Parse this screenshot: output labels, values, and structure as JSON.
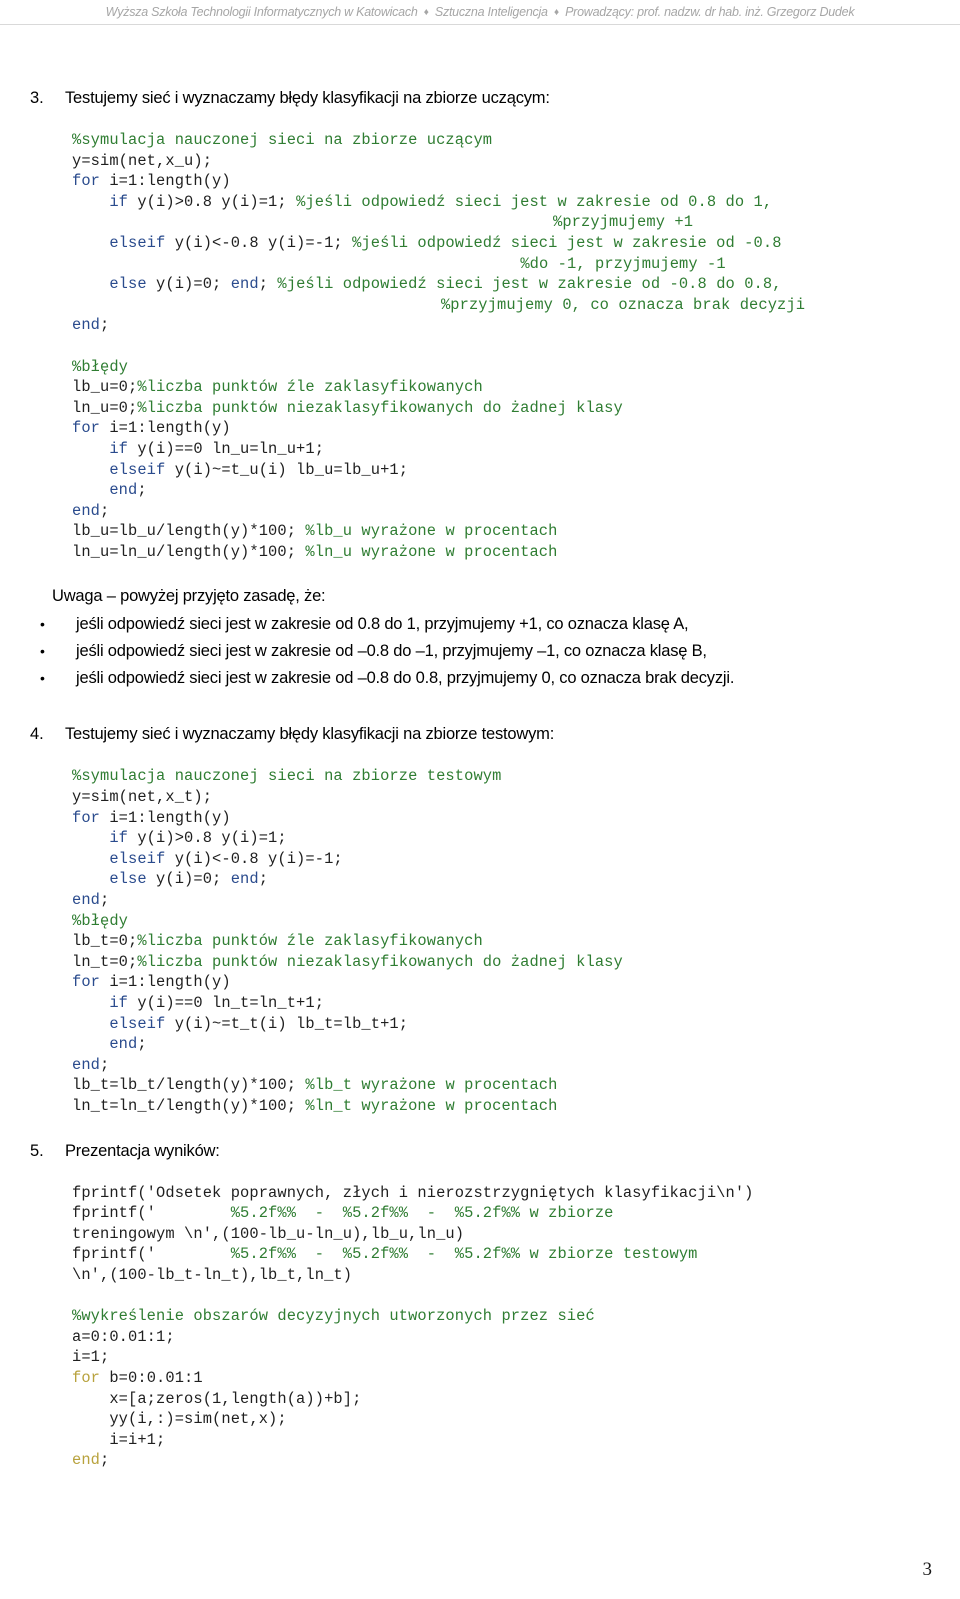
{
  "header": {
    "institution": "Wyższa Szkoła Technologii Informatycznych w Katowicach",
    "course": "Sztuczna Inteligencja",
    "lecturer": "Prowadzący: prof. nadzw. dr hab. inż. Grzegorz Dudek",
    "separator": "♦"
  },
  "colors": {
    "header_text": "#a6a6a6",
    "comment_green": "#2f7d32",
    "keyword_blue": "#2a4b8d",
    "keyword_olive": "#b8a23d",
    "body_text": "#000000"
  },
  "steps": [
    {
      "number": "3.",
      "title": "Testujemy sieć i wyznaczamy błędy klasyfikacji na zbiorze uczącym:"
    },
    {
      "number": "4.",
      "title": "Testujemy sieć i wyznaczamy błędy klasyfikacji na zbiorze testowym:"
    },
    {
      "number": "5.",
      "title": "Prezentacja wyników:"
    }
  ],
  "code_block_1": {
    "lines": [
      "%symulacja nauczonej sieci na zbiorze uczącym",
      "y=sim(net,x_u);",
      "for i=1:length(y)",
      "    if y(i)>0.8 y(i)=1; %jeśli odpowiedź sieci jest w zakresie od 0.8 do 1,",
      "                        %przyjmujemy +1",
      "    elseif y(i)<-0.8 y(i)=-1; %jeśli odpowiedź sieci jest w zakresie od -0.8",
      "                        %do -1, przyjmujemy -1",
      "    else y(i)=0; end; %jeśli odpowiedź sieci jest w zakresie od -0.8 do 0.8,",
      "                        %przyjmujemy 0, co oznacza brak decyzji",
      "end;",
      "",
      "%błędy",
      "lb_u=0;%liczba punktów źle zaklasyfikowanych",
      "ln_u=0;%liczba punktów niezaklasyfikowanych do żadnej klasy",
      "for i=1:length(y)",
      "    if y(i)==0 ln_u=ln_u+1;",
      "    elseif y(i)~=t_u(i) lb_u=lb_u+1;",
      "    end;",
      "end;",
      "lb_u=lb_u/length(y)*100; %lb_u wyrażone w procentach",
      "ln_u=ln_u/length(y)*100; %ln_u wyrażone w procentach"
    ]
  },
  "note": {
    "intro": "Uwaga – powyżej przyjęto zasadę, że:",
    "bullet_char": "•",
    "bullets": [
      "jeśli odpowiedź sieci jest w zakresie od 0.8 do 1, przyjmujemy +1, co oznacza klasę A,",
      "jeśli odpowiedź sieci jest w zakresie od –0.8 do –1, przyjmujemy –1, co oznacza klasę B,",
      "jeśli odpowiedź sieci jest w zakresie od –0.8 do 0.8, przyjmujemy 0, co oznacza brak decyzji."
    ]
  },
  "code_block_2": {
    "lines": [
      "%symulacja nauczonej sieci na zbiorze testowym",
      "y=sim(net,x_t);",
      "for i=1:length(y)",
      "    if y(i)>0.8 y(i)=1;",
      "    elseif y(i)<-0.8 y(i)=-1;",
      "    else y(i)=0; end;",
      "end;",
      "%błędy",
      "lb_t=0;%liczba punktów źle zaklasyfikowanych",
      "ln_t=0;%liczba punktów niezaklasyfikowanych do żadnej klasy",
      "for i=1:length(y)",
      "    if y(i)==0 ln_t=ln_t+1;",
      "    elseif y(i)~=t_t(i) lb_t=lb_t+1;",
      "    end;",
      "end;",
      "lb_t=lb_t/length(y)*100; %lb_t wyrażone w procentach",
      "ln_t=ln_t/length(y)*100; %ln_t wyrażone w procentach"
    ]
  },
  "code_block_3": {
    "lines": [
      "fprintf('Odsetek poprawnych, złych i nierozstrzygniętych klasyfikacji\\n')",
      "fprintf('        %5.2f%%  -  %5.2f%%  -  %5.2f%% w zbiorze",
      "treningowym \\n',(100-lb_u-ln_u),lb_u,ln_u)",
      "fprintf('        %5.2f%%  -  %5.2f%%  -  %5.2f%% w zbiorze testowym",
      "\\n',(100-lb_t-ln_t),lb_t,ln_t)",
      "",
      "%wykreślenie obszarów decyzyjnych utworzonych przez sieć",
      "a=0:0.01:1;",
      "i=1;",
      "for b=0:0.01:1",
      "    x=[a;zeros(1,length(a))+b];",
      "    yy(i,:)=sim(net,x);",
      "    i=i+1;",
      "end;"
    ]
  },
  "footer": {
    "page_number": "3"
  }
}
